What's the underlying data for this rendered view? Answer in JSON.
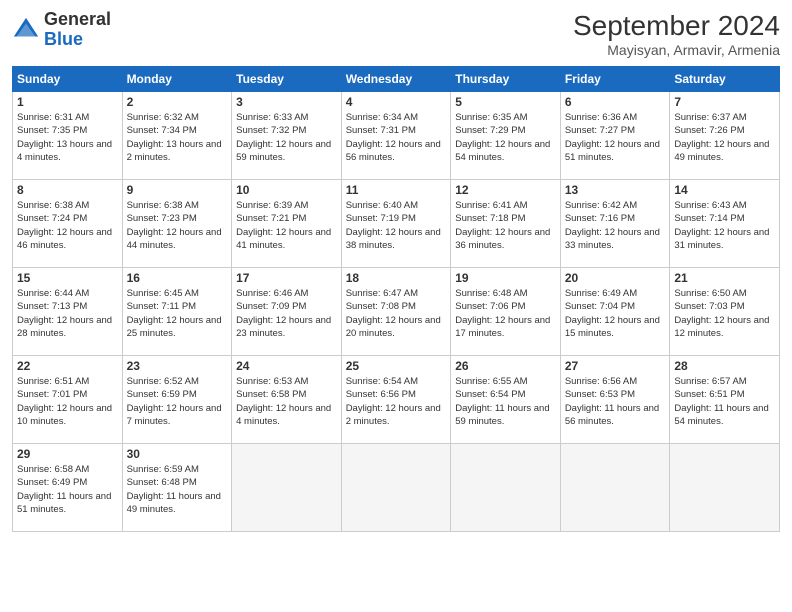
{
  "header": {
    "logo_general": "General",
    "logo_blue": "Blue",
    "month_title": "September 2024",
    "location": "Mayisyan, Armavir, Armenia"
  },
  "calendar": {
    "days_of_week": [
      "Sunday",
      "Monday",
      "Tuesday",
      "Wednesday",
      "Thursday",
      "Friday",
      "Saturday"
    ],
    "weeks": [
      [
        {
          "day": "1",
          "sunrise": "6:31 AM",
          "sunset": "7:35 PM",
          "daylight": "13 hours and 4 minutes."
        },
        {
          "day": "2",
          "sunrise": "6:32 AM",
          "sunset": "7:34 PM",
          "daylight": "13 hours and 2 minutes."
        },
        {
          "day": "3",
          "sunrise": "6:33 AM",
          "sunset": "7:32 PM",
          "daylight": "12 hours and 59 minutes."
        },
        {
          "day": "4",
          "sunrise": "6:34 AM",
          "sunset": "7:31 PM",
          "daylight": "12 hours and 56 minutes."
        },
        {
          "day": "5",
          "sunrise": "6:35 AM",
          "sunset": "7:29 PM",
          "daylight": "12 hours and 54 minutes."
        },
        {
          "day": "6",
          "sunrise": "6:36 AM",
          "sunset": "7:27 PM",
          "daylight": "12 hours and 51 minutes."
        },
        {
          "day": "7",
          "sunrise": "6:37 AM",
          "sunset": "7:26 PM",
          "daylight": "12 hours and 49 minutes."
        }
      ],
      [
        {
          "day": "8",
          "sunrise": "6:38 AM",
          "sunset": "7:24 PM",
          "daylight": "12 hours and 46 minutes."
        },
        {
          "day": "9",
          "sunrise": "6:38 AM",
          "sunset": "7:23 PM",
          "daylight": "12 hours and 44 minutes."
        },
        {
          "day": "10",
          "sunrise": "6:39 AM",
          "sunset": "7:21 PM",
          "daylight": "12 hours and 41 minutes."
        },
        {
          "day": "11",
          "sunrise": "6:40 AM",
          "sunset": "7:19 PM",
          "daylight": "12 hours and 38 minutes."
        },
        {
          "day": "12",
          "sunrise": "6:41 AM",
          "sunset": "7:18 PM",
          "daylight": "12 hours and 36 minutes."
        },
        {
          "day": "13",
          "sunrise": "6:42 AM",
          "sunset": "7:16 PM",
          "daylight": "12 hours and 33 minutes."
        },
        {
          "day": "14",
          "sunrise": "6:43 AM",
          "sunset": "7:14 PM",
          "daylight": "12 hours and 31 minutes."
        }
      ],
      [
        {
          "day": "15",
          "sunrise": "6:44 AM",
          "sunset": "7:13 PM",
          "daylight": "12 hours and 28 minutes."
        },
        {
          "day": "16",
          "sunrise": "6:45 AM",
          "sunset": "7:11 PM",
          "daylight": "12 hours and 25 minutes."
        },
        {
          "day": "17",
          "sunrise": "6:46 AM",
          "sunset": "7:09 PM",
          "daylight": "12 hours and 23 minutes."
        },
        {
          "day": "18",
          "sunrise": "6:47 AM",
          "sunset": "7:08 PM",
          "daylight": "12 hours and 20 minutes."
        },
        {
          "day": "19",
          "sunrise": "6:48 AM",
          "sunset": "7:06 PM",
          "daylight": "12 hours and 17 minutes."
        },
        {
          "day": "20",
          "sunrise": "6:49 AM",
          "sunset": "7:04 PM",
          "daylight": "12 hours and 15 minutes."
        },
        {
          "day": "21",
          "sunrise": "6:50 AM",
          "sunset": "7:03 PM",
          "daylight": "12 hours and 12 minutes."
        }
      ],
      [
        {
          "day": "22",
          "sunrise": "6:51 AM",
          "sunset": "7:01 PM",
          "daylight": "12 hours and 10 minutes."
        },
        {
          "day": "23",
          "sunrise": "6:52 AM",
          "sunset": "6:59 PM",
          "daylight": "12 hours and 7 minutes."
        },
        {
          "day": "24",
          "sunrise": "6:53 AM",
          "sunset": "6:58 PM",
          "daylight": "12 hours and 4 minutes."
        },
        {
          "day": "25",
          "sunrise": "6:54 AM",
          "sunset": "6:56 PM",
          "daylight": "12 hours and 2 minutes."
        },
        {
          "day": "26",
          "sunrise": "6:55 AM",
          "sunset": "6:54 PM",
          "daylight": "11 hours and 59 minutes."
        },
        {
          "day": "27",
          "sunrise": "6:56 AM",
          "sunset": "6:53 PM",
          "daylight": "11 hours and 56 minutes."
        },
        {
          "day": "28",
          "sunrise": "6:57 AM",
          "sunset": "6:51 PM",
          "daylight": "11 hours and 54 minutes."
        }
      ],
      [
        {
          "day": "29",
          "sunrise": "6:58 AM",
          "sunset": "6:49 PM",
          "daylight": "11 hours and 51 minutes."
        },
        {
          "day": "30",
          "sunrise": "6:59 AM",
          "sunset": "6:48 PM",
          "daylight": "11 hours and 49 minutes."
        },
        null,
        null,
        null,
        null,
        null
      ]
    ]
  }
}
